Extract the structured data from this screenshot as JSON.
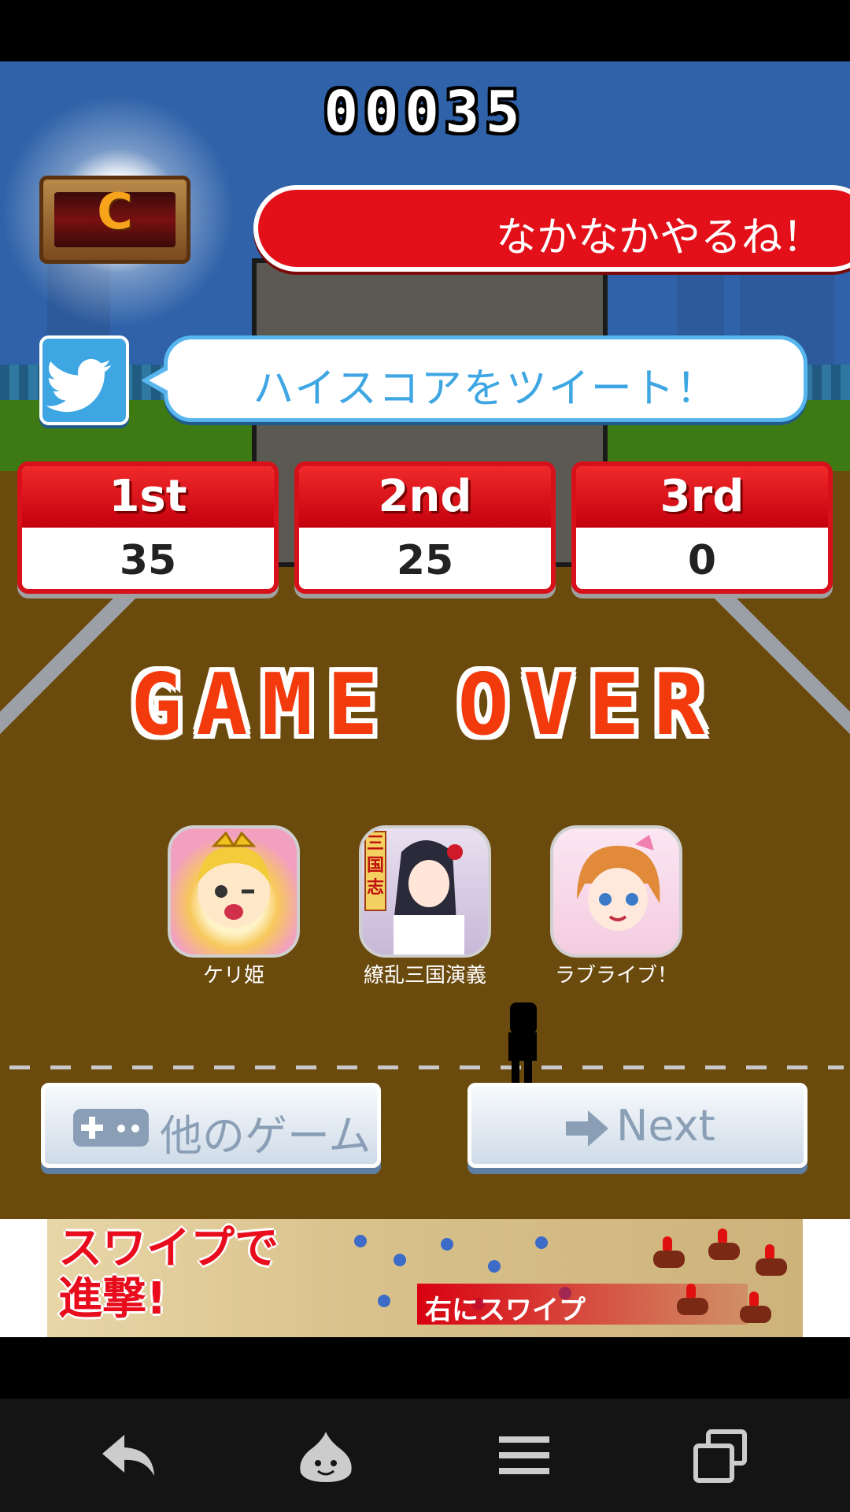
{
  "score": "00035",
  "rank_letter": "C",
  "message": "なかなかやるね！",
  "tweet_label": "ハイスコアをツイート！",
  "high_scores": [
    {
      "label": "1st",
      "value": "35"
    },
    {
      "label": "2nd",
      "value": "25"
    },
    {
      "label": "3rd",
      "value": "0"
    }
  ],
  "game_over": "GAME OVER",
  "recommended_apps": [
    {
      "name": "ケリ姫"
    },
    {
      "name": "繚乱三国演義",
      "icon_text": "三国志"
    },
    {
      "name": "ラブライブ！"
    }
  ],
  "buttons": {
    "other_games": "他のゲーム",
    "next": "Next"
  },
  "ad": {
    "headline": "スワイプで進撃!",
    "headline_line1": "スワイプで",
    "headline_line2": "進撃!",
    "tagline": "右にスワイプ"
  },
  "colors": {
    "sky": "#2f62a9",
    "dirt": "#6b4a0e",
    "accent_red": "#e3101a",
    "twitter_blue": "#3ea6e3",
    "game_over": "#f23a0c"
  },
  "icons": {
    "nav": [
      "back-icon",
      "slime-home-icon",
      "menu-icon",
      "recent-apps-icon"
    ]
  }
}
